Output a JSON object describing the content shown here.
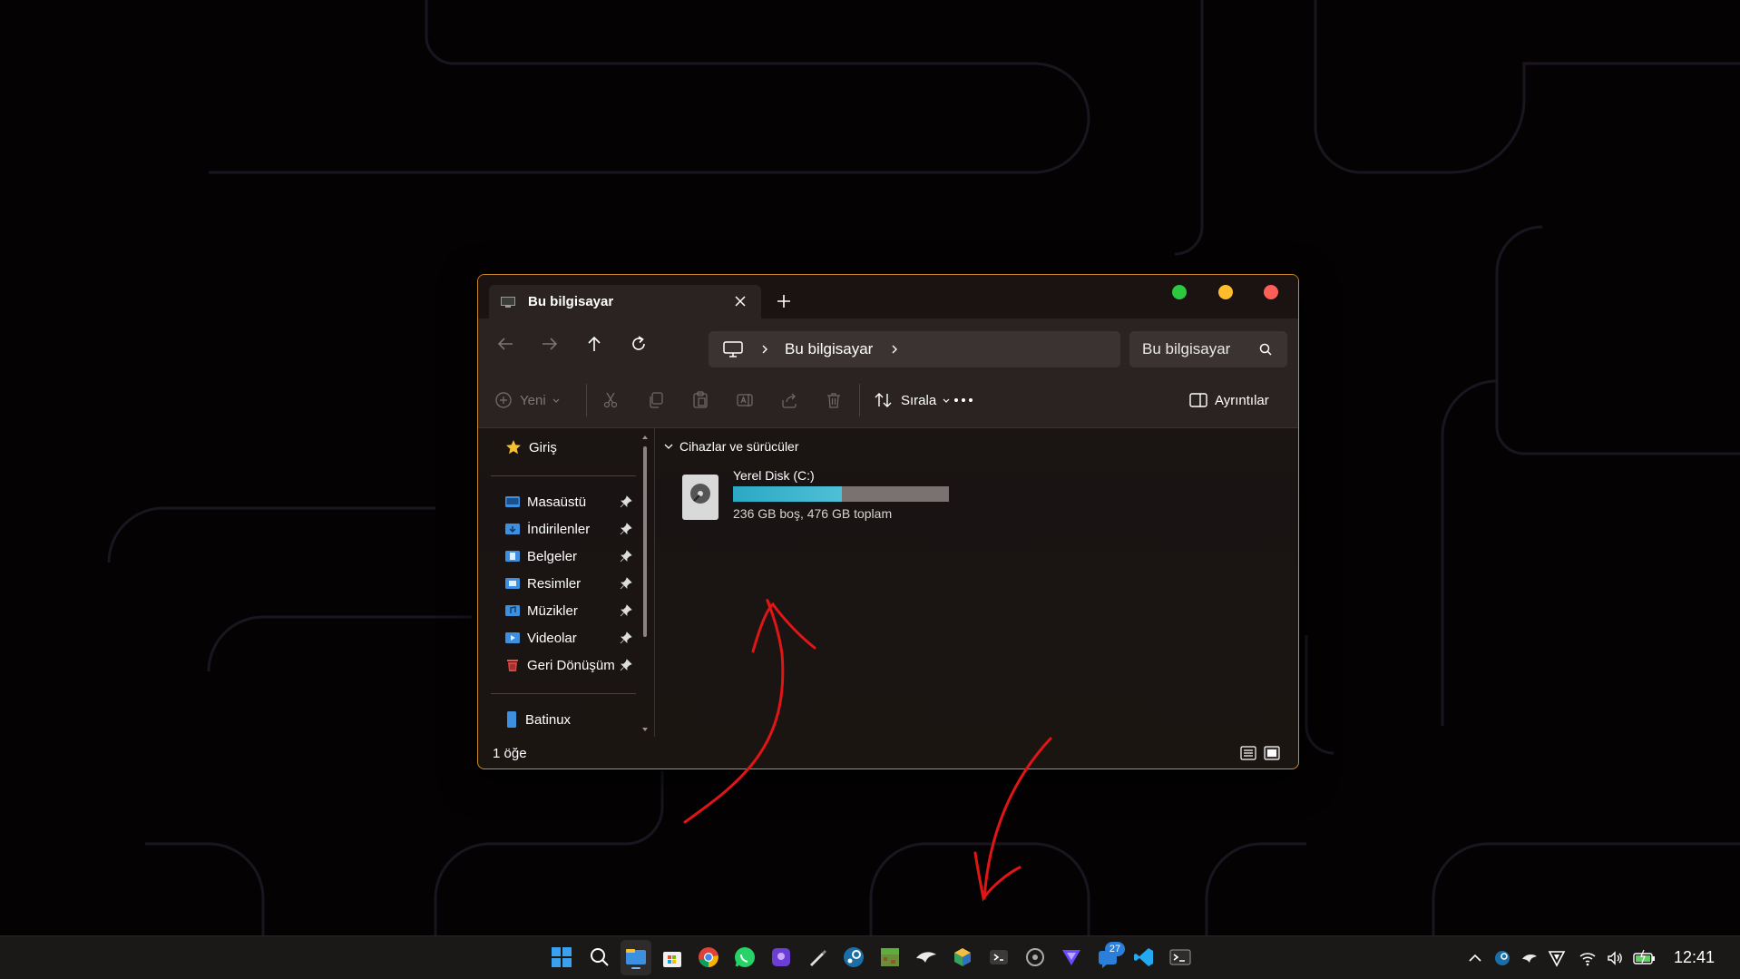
{
  "window": {
    "tab_title": "Bu bilgisayar",
    "address_crumb": "Bu bilgisayar",
    "search_text": "Bu bilgisayar"
  },
  "toolbar": {
    "new_label": "Yeni",
    "sort_label": "Sırala",
    "details_label": "Ayrıntılar"
  },
  "sidebar": {
    "home": "Giriş",
    "items": [
      {
        "label": "Masaüstü",
        "icon": "desktop-folder-icon",
        "pinned": true
      },
      {
        "label": "İndirilenler",
        "icon": "downloads-folder-icon",
        "pinned": true
      },
      {
        "label": "Belgeler",
        "icon": "documents-folder-icon",
        "pinned": true
      },
      {
        "label": "Resimler",
        "icon": "pictures-folder-icon",
        "pinned": true
      },
      {
        "label": "Müzikler",
        "icon": "music-folder-icon",
        "pinned": true
      },
      {
        "label": "Videolar",
        "icon": "videos-folder-icon",
        "pinned": true
      },
      {
        "label": "Geri Dönüşüm",
        "icon": "recycle-bin-icon",
        "pinned": true
      }
    ],
    "user": "Batinux"
  },
  "content": {
    "section_title": "Cihazlar ve sürücüler",
    "drive": {
      "name": "Yerel Disk (C:)",
      "usage_fraction": 0.504,
      "summary": "236 GB boş, 476 GB toplam"
    }
  },
  "status": {
    "item_count": "1 öğe"
  },
  "taskbar": {
    "notification_badge": "27",
    "clock": "12:41"
  },
  "colors": {
    "window_border": "#c98a2a",
    "annotation_ink": "#e01515",
    "drive_fill": "#2ba8c4"
  }
}
